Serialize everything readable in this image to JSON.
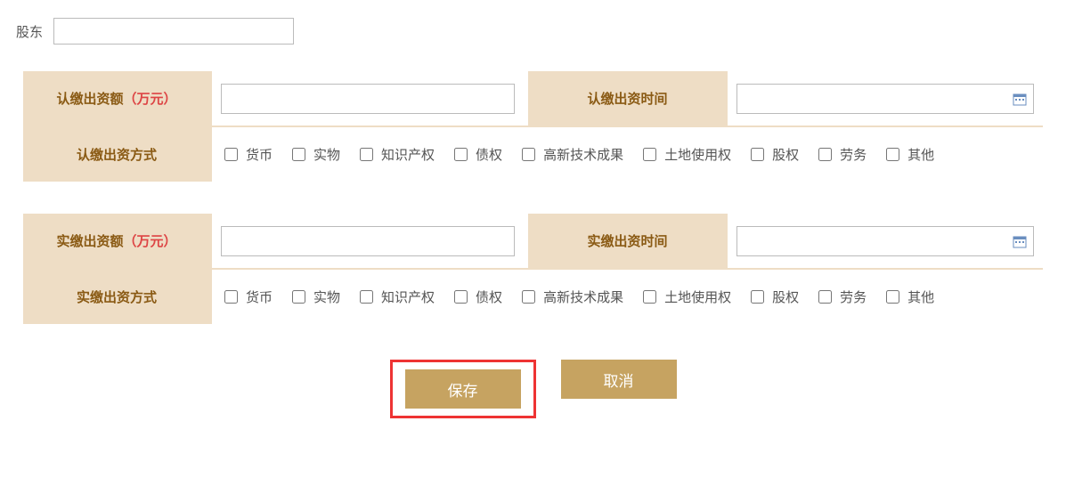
{
  "shareholder": {
    "label": "股东",
    "value": ""
  },
  "subscribed": {
    "amount_label": "认缴出资额",
    "amount_unit": "（万元）",
    "amount_value": "",
    "time_label": "认缴出资时间",
    "time_value": "",
    "method_label": "认缴出资方式",
    "options": [
      "货币",
      "实物",
      "知识产权",
      "债权",
      "高新技术成果",
      "土地使用权",
      "股权",
      "劳务",
      "其他"
    ]
  },
  "paid": {
    "amount_label": "实缴出资额",
    "amount_unit": "（万元）",
    "amount_value": "",
    "time_label": "实缴出资时间",
    "time_value": "",
    "method_label": "实缴出资方式",
    "options": [
      "货币",
      "实物",
      "知识产权",
      "债权",
      "高新技术成果",
      "土地使用权",
      "股权",
      "劳务",
      "其他"
    ]
  },
  "buttons": {
    "save": "保存",
    "cancel": "取消"
  }
}
